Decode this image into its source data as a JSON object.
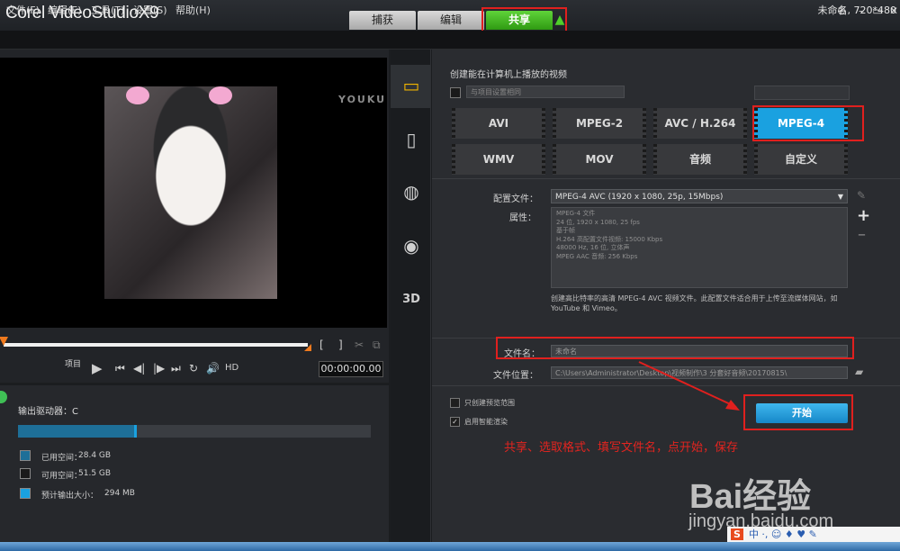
{
  "app": {
    "brand": "Corel VideoStudioX9",
    "project_name": "未命名, 720*480"
  },
  "steps": [
    {
      "label": "捕获"
    },
    {
      "label": "编辑"
    },
    {
      "label": "共享"
    }
  ],
  "menu": [
    "文件(F)",
    "编辑(E)",
    "工具(T)",
    "设置(S)",
    "帮助(H)"
  ],
  "preview": {
    "watermark": "YOUKU",
    "mode_label": "项目",
    "hd_label": "HD",
    "timecode": "00:00:00.00"
  },
  "drive": {
    "label": "输出驱动器：C",
    "used_fraction": 0.33,
    "legend": [
      {
        "label": "已用空间：",
        "value": "28.4 GB",
        "color": "#1e6f98"
      },
      {
        "label": "可用空间：",
        "value": "51.5 GB",
        "color": "#1a1a1a"
      },
      {
        "label": "预计输出大小：",
        "value": "294 MB",
        "color": "#1aa1e0"
      }
    ]
  },
  "share": {
    "heading": "创建能在计算机上播放的视频",
    "preset_placeholder": "与项目设置相同",
    "formats": [
      "AVI",
      "MPEG-2",
      "AVC / H.264",
      "MPEG-4",
      "WMV",
      "MOV",
      "音频",
      "自定义"
    ],
    "selected_format": "MPEG-4",
    "profile_label": "配置文件：",
    "profile_value": "MPEG-4 AVC (1920 x 1080, 25p, 15Mbps)",
    "props_label": "属性：",
    "props_lines": [
      "MPEG-4 文件",
      "24 位, 1920 x 1080, 25 fps",
      "基于帧",
      "H.264 高配置文件视频: 15000 Kbps",
      "48000 Hz, 16 位, 立体声",
      "MPEG AAC 音频: 256 Kbps"
    ],
    "description": "创建高比特率的高清 MPEG-4 AVC 视频文件。此配置文件适合用于上传至流媒体网站，如 YouTube 和 Vimeo。",
    "filename_label": "文件名：",
    "filename_value": "未命名",
    "filepath_label": "文件位置：",
    "filepath_value": "C:\\Users\\Administrator\\Desktop\\视频制作\\3 分套好音频\\20170815\\",
    "preview_range_label": "只创建预览范围",
    "smart_render_label": "启用智能渲染",
    "start_label": "开始"
  },
  "annotation": "共享、选取格式、填写文件名，点开始，保存",
  "watermark": {
    "brand": "Bai经验",
    "url": "jingyan.baidu.com"
  },
  "ime": "中 ·, ☺ ♦ ♥ ✎"
}
